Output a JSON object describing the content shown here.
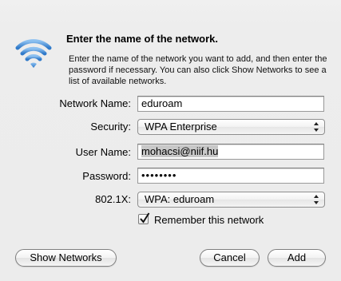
{
  "icons": {
    "network": "wifi-signal-icon",
    "checkmark": "checkmark-icon",
    "popup_arrows": "up-down-arrows-icon"
  },
  "colors": {
    "wifi_blue": "#4a8fd8",
    "background": "#ececec"
  },
  "header": {
    "title": "Enter the name of the network.",
    "description": "Enter the name of the network you want to add, and then enter the password if necessary. You can also click Show Networks to see a list of available networks."
  },
  "form": {
    "network_name": {
      "label": "Network Name:",
      "value": "eduroam"
    },
    "security": {
      "label": "Security:",
      "selected": "WPA Enterprise"
    },
    "user_name": {
      "label": "User Name:",
      "value": "mohacsi@niif.hu"
    },
    "password": {
      "label": "Password:",
      "value": "••••••••"
    },
    "dot1x": {
      "label": "802.1X:",
      "selected": "WPA: eduroam"
    },
    "remember": {
      "label": "Remember this network",
      "checked": true
    }
  },
  "buttons": {
    "show_networks": "Show Networks",
    "cancel": "Cancel",
    "add": "Add"
  }
}
